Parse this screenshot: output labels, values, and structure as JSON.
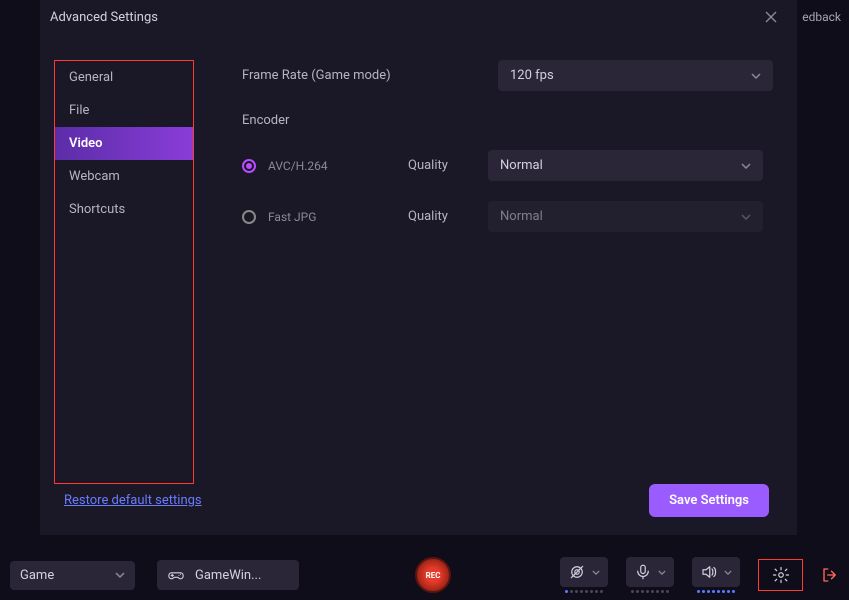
{
  "feedback_label": "edback",
  "modal": {
    "title": "Advanced Settings",
    "sidebar": {
      "items": [
        {
          "label": "General"
        },
        {
          "label": "File"
        },
        {
          "label": "Video"
        },
        {
          "label": "Webcam"
        },
        {
          "label": "Shortcuts"
        }
      ],
      "active_index": 2
    },
    "frame_rate": {
      "label": "Frame Rate (Game mode)",
      "value": "120 fps"
    },
    "encoder": {
      "label": "Encoder",
      "options": [
        {
          "label": "AVC/H.264",
          "selected": true,
          "quality_label": "Quality",
          "quality_value": "Normal"
        },
        {
          "label": "Fast JPG",
          "selected": false,
          "quality_label": "Quality",
          "quality_value": "Normal"
        }
      ]
    },
    "restore_label": "Restore default settings",
    "save_label": "Save Settings"
  },
  "bottombar": {
    "mode": "Game",
    "target": "GameWin...",
    "rec_label": "REC"
  },
  "colors": {
    "accent": "#9b5cff",
    "highlight_border": "#ff3b30",
    "bg": "#0f0d1a",
    "panel": "#1a1726",
    "field": "#2a2638"
  }
}
